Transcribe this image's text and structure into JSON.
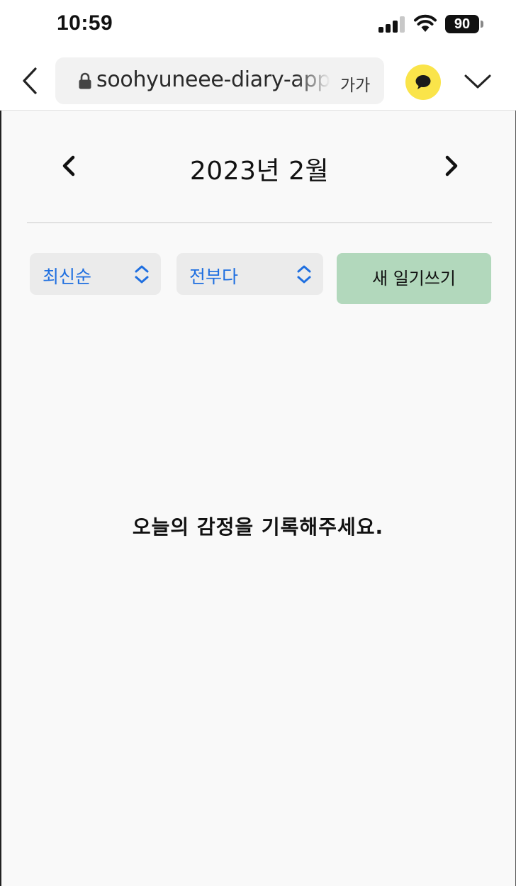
{
  "status_bar": {
    "time": "10:59",
    "battery": "90",
    "icons": [
      "cellular-signal-icon",
      "wifi-icon",
      "battery-icon"
    ]
  },
  "browser": {
    "url": "soohyuneee-diary-app",
    "text_size_label": "가가",
    "icons": [
      "back-chevron-icon",
      "lock-icon",
      "kakao-talk-icon",
      "chevron-down-icon"
    ],
    "kakao_color": "#fae44a"
  },
  "header": {
    "month_title": "2023년 2월",
    "prev_icon": "chevron-left-icon",
    "next_icon": "chevron-right-icon"
  },
  "controls": {
    "sort_select": {
      "value": "최신순"
    },
    "filter_select": {
      "value": "전부다"
    },
    "new_button_label": "새 일기쓰기",
    "new_button_color": "#b2d8bc",
    "select_text_color": "#1f6fe0"
  },
  "main": {
    "empty_message": "오늘의 감정을 기록해주세요."
  }
}
